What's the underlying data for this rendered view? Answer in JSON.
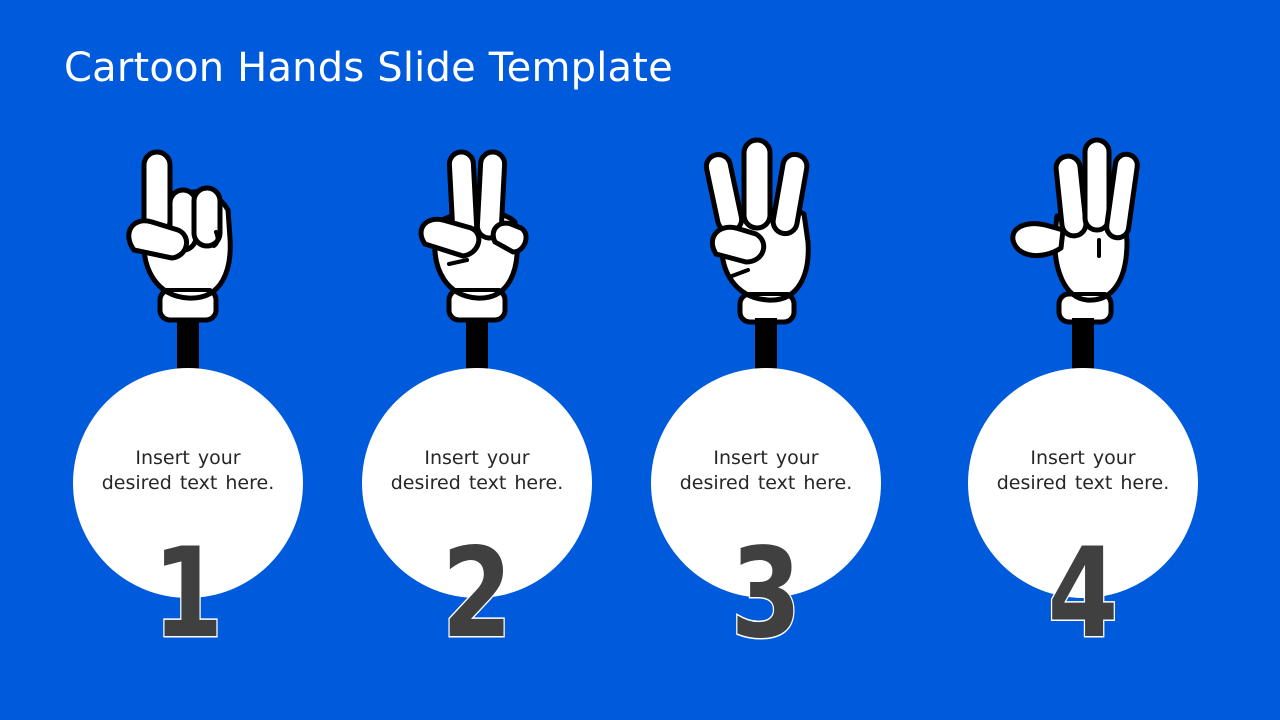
{
  "slide": {
    "title": "Cartoon Hands Slide Template",
    "background_color": "#005ADC"
  },
  "items": [
    {
      "number": "1",
      "icon": "one-finger-hand-icon",
      "text_line1": "Insert your",
      "text_line2": "desired text here."
    },
    {
      "number": "2",
      "icon": "peace-sign-hand-icon",
      "text_line1": "Insert your",
      "text_line2": "desired text here."
    },
    {
      "number": "3",
      "icon": "three-fingers-hand-icon",
      "text_line1": "Insert your",
      "text_line2": "desired text here."
    },
    {
      "number": "4",
      "icon": "four-fingers-hand-icon",
      "text_line1": "Insert your",
      "text_line2": "desired text here."
    }
  ],
  "colors": {
    "circle": "#FFFFFF",
    "number": "#404040",
    "text": "#262626",
    "glove_outline": "#000000",
    "glove_fill": "#FFFFFF"
  }
}
